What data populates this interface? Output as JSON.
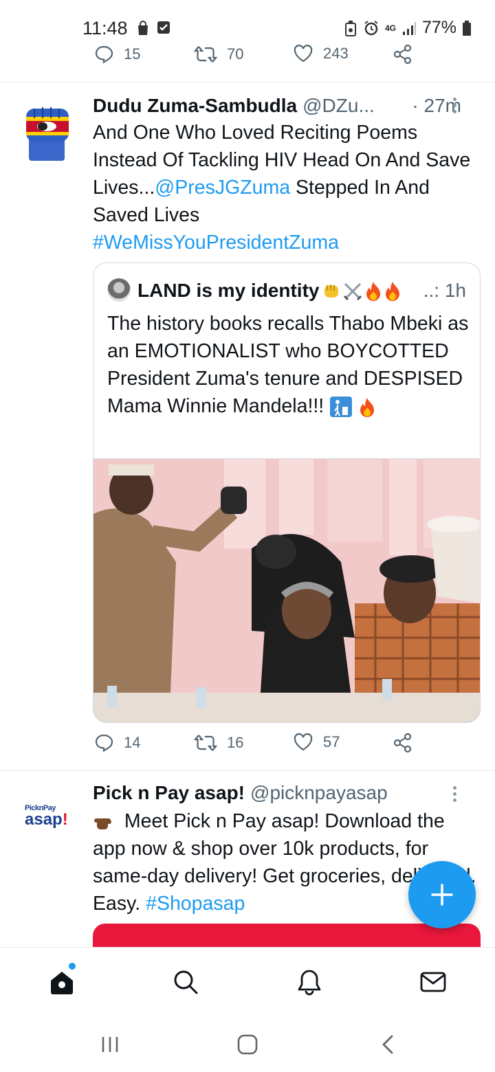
{
  "status_bar": {
    "time": "11:48",
    "battery": "77%",
    "network": "4G",
    "icons": [
      "bag-icon",
      "checkbox-icon",
      "lock-battery-icon",
      "alarm-icon",
      "network-4g-icon",
      "signal-icon",
      "battery-icon"
    ]
  },
  "prev_tweet_actions": {
    "replies": "15",
    "retweets": "70",
    "likes": "243"
  },
  "tweet": {
    "name": "Dudu Zuma-Sambudla",
    "handle": "@DZu...",
    "time": "· 27m",
    "text_part1": "And One Who Loved Reciting Poems Instead Of Tackling HIV Head On And Save Lives...",
    "mention": "@PresJGZuma",
    "text_part2": " Stepped In And Saved Lives",
    "hashtag": "#WeMissYouPresidentZuma",
    "quote": {
      "name": "LAND is my identity",
      "time": "..: 1h",
      "text": "The history books recalls Thabo Mbeki as an EMOTIONALIST who BOYCOTTED President Zuma's tenure and DESPISED Mama Winnie Mandela!!!"
    },
    "actions": {
      "replies": "14",
      "retweets": "16",
      "likes": "57"
    }
  },
  "ad_tweet": {
    "name": "Pick n Pay asap!",
    "handle": "@picknpayasap",
    "avatar_small": "PicknPay",
    "avatar_big": "asap",
    "avatar_excl": "!",
    "text": " Meet Pick n Pay asap! Download the app now & shop over 10k products, for same-day delivery! Get groceries, delivered. Easy. ",
    "hashtag": "#Shopasap"
  },
  "bottom_nav": [
    "home-icon",
    "search-icon",
    "notifications-icon",
    "messages-icon"
  ],
  "colors": {
    "accent": "#1d9bf0",
    "text": "#0f1419",
    "muted": "#536471",
    "ad_red": "#e8173b"
  }
}
